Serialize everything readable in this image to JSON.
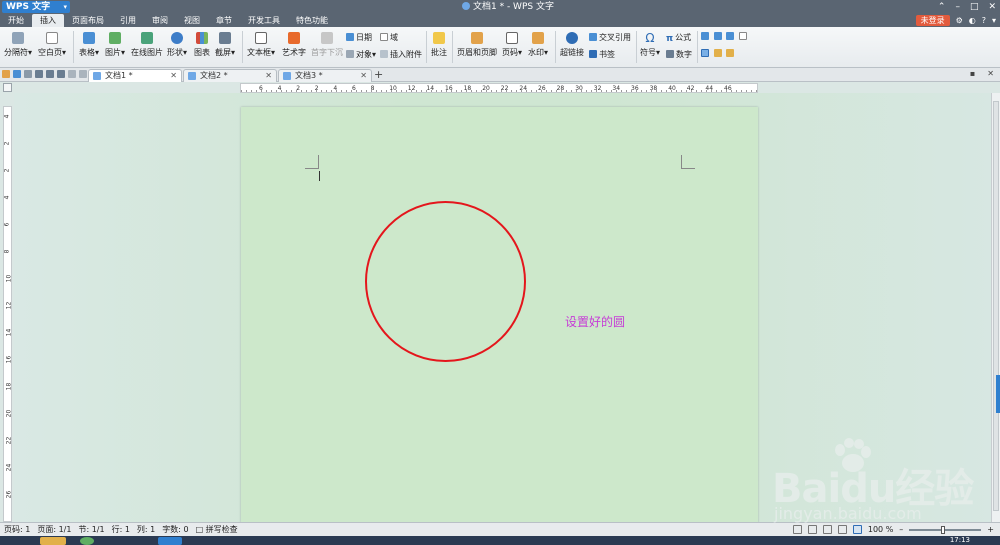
{
  "app": {
    "name": "WPS 文字",
    "window_title": "文档1 * - WPS 文字"
  },
  "menubar": {
    "items": [
      "开始",
      "插入",
      "页面布局",
      "引用",
      "审阅",
      "视图",
      "章节",
      "开发工具",
      "特色功能"
    ],
    "active": "插入",
    "login": "未登录"
  },
  "ribbon": {
    "page_break": "分隔符",
    "blank_page": "空白页",
    "table": "表格",
    "picture": "图片",
    "online_picture": "在线图片",
    "shape": "形状",
    "chart": "图表",
    "screenshot": "截屏",
    "text_box": "文本框",
    "word_art": "艺术字",
    "drop_cap": "首字下沉",
    "date": "日期",
    "field": "域",
    "object": "对象",
    "attachment": "插入附件",
    "comment": "批注",
    "header_footer": "页眉和页脚",
    "page_number": "页码",
    "watermark": "水印",
    "hyperlink": "超链接",
    "cross_ref": "交叉引用",
    "bookmark": "书签",
    "symbol": "符号",
    "formula": "公式",
    "number": "数字"
  },
  "tabs": [
    {
      "label": "文档1 *",
      "active": true
    },
    {
      "label": "文档2 *",
      "active": false
    },
    {
      "label": "文档3 *",
      "active": false
    }
  ],
  "ruler": {
    "marks": [
      "6",
      "4",
      "2",
      "2",
      "4",
      "6",
      "8",
      "10",
      "12",
      "14",
      "16",
      "18",
      "20",
      "22",
      "24",
      "26",
      "28",
      "30",
      "32",
      "34",
      "36",
      "38",
      "40",
      "42",
      "44",
      "46"
    ],
    "vmarks": [
      "4",
      "2",
      "2",
      "4",
      "6",
      "8",
      "10",
      "12",
      "14",
      "16",
      "18",
      "20",
      "22",
      "24",
      "26"
    ]
  },
  "document": {
    "annotation": "设置好的圆",
    "circle_color": "#e4161c",
    "annotation_color": "#c63cd6"
  },
  "status": {
    "page_num": "页码: 1",
    "pages": "页面: 1/1",
    "section": "节: 1/1",
    "line": "行: 1",
    "column": "列: 1",
    "word_count": "字数: 0",
    "spell_check": "拼写检查",
    "zoom": "100 %"
  },
  "taskbar": {
    "time": "17:13"
  },
  "watermark": {
    "brand": "Baidu经验",
    "url": "jingyan.baidu.com"
  }
}
